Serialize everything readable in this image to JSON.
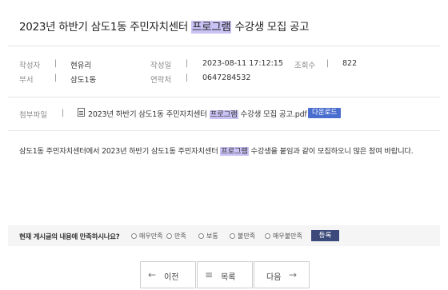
{
  "post": {
    "title_pre": "2023년 하반기 삼도1동 주민자치센터 ",
    "title_hl": "프로그램",
    "title_post": " 수강생 모집 공고"
  },
  "meta": {
    "author_label": "작성자",
    "author": "현유리",
    "date_label": "작성일",
    "date": "2023-08-11 17:12:15",
    "views_label": "조회수",
    "views": "822",
    "dept_label": "부서",
    "dept": "삼도1동",
    "contact_label": "연락처",
    "contact": "0647284532",
    "separator": "|"
  },
  "attachment": {
    "label": "첨부파일",
    "file_pre": "2023년 하반기 삼도1동 주민자치센터 ",
    "file_hl": "프로그램",
    "file_post": " 수강생 모집 공고.pdf",
    "download_label": "다운로드"
  },
  "content": {
    "text_pre": "삼도1동 주민자치센터에서 2023년 하반기 삼도1동 주민자치센터 ",
    "text_hl": "프로그램",
    "text_post": " 수강생을 붙임과 같이 모집하오니 많은 참여 바랍니다."
  },
  "survey": {
    "question": "현재 게시글의 내용에 만족하시나요?",
    "options": [
      "매우만족",
      "만족",
      "보통",
      "불만족",
      "매우불만족"
    ],
    "submit_label": "등록"
  },
  "nav": {
    "prev_label": "이전",
    "list_label": "목록",
    "next_label": "다음",
    "prev_icon": "←",
    "list_icon": "≡",
    "next_icon": "→"
  },
  "colors": {
    "highlight": "#c9c2f5",
    "download_button": "#4a6ecf",
    "submit_button": "#3b4a7a"
  }
}
